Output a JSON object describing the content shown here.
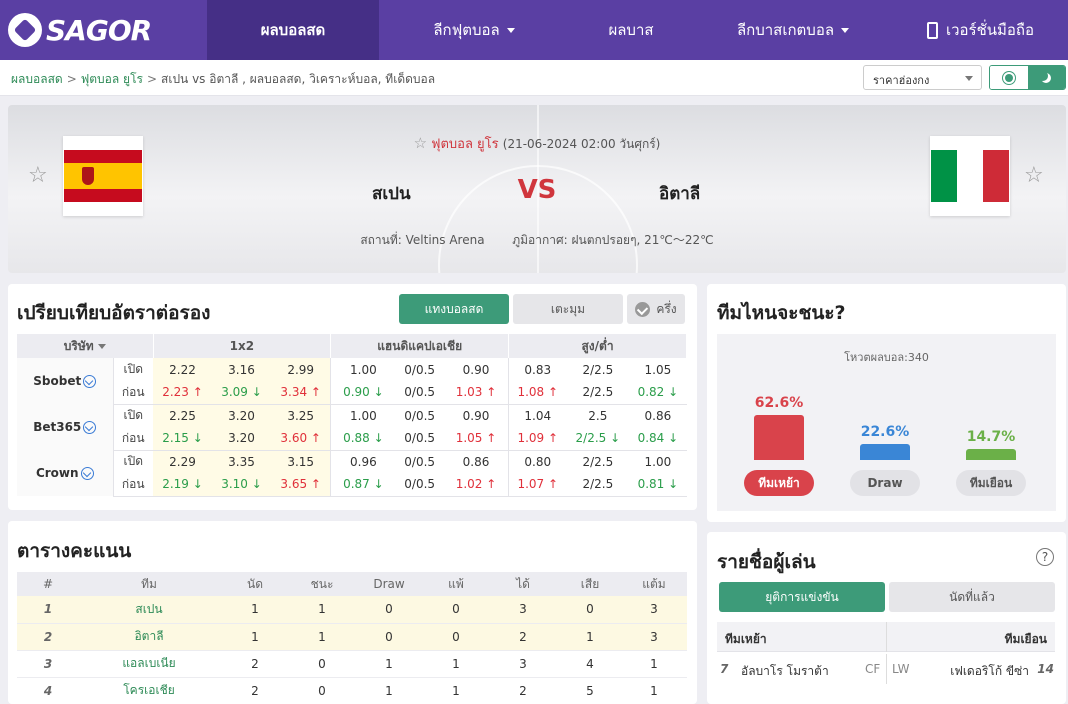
{
  "nav": {
    "logo": "SAGOR",
    "items": [
      {
        "label": "ผลบอลสด",
        "active": true,
        "caret": false
      },
      {
        "label": "ลีกฟุตบอล",
        "active": false,
        "caret": true
      },
      {
        "label": "ผลบาส",
        "active": false,
        "caret": false
      },
      {
        "label": "ลีกบาสเกตบอล",
        "active": false,
        "caret": true
      },
      {
        "label": "เวอร์ชั่นมือถือ",
        "active": false,
        "caret": false
      }
    ]
  },
  "breadcrumb": {
    "home": "ผลบอลสด",
    "league": "ฟุตบอล ยูโร",
    "current": "สเปน vs อิตาลี , ผลบอลสด, วิเคราะห์บอล, ทีเด็ดบอล"
  },
  "odds_select": {
    "value": "ราคาฮ่องกง"
  },
  "match": {
    "competition": "ฟุตบอล ยูโร",
    "datetime": "(21-06-2024 02:00 วันศุกร์)",
    "home": "สเปน",
    "away": "อิตาลี",
    "vs": "VS",
    "venue": "สถานที่: Veltins Arena",
    "weather": "ภูมิอากาศ: ฝนตกปรอยๆ, 21℃～22℃",
    "colors": {
      "spain_red": "#c60b1e",
      "spain_yellow": "#ffc400",
      "italy_green": "#009246",
      "italy_white": "#ffffff",
      "italy_red": "#ce2b37"
    }
  },
  "odds": {
    "title": "เปรียบเทียบอัตราต่อรอง",
    "btn_live": "แทงบอลสด",
    "btn_angle": "เตะมุม",
    "btn_half": "ครึ่ง",
    "headers": {
      "company": "บริษัท",
      "x12": "1x2",
      "handicap": "แฮนดิแคปเอเชีย",
      "ou": "สูง/ต่ำ"
    },
    "label_open": "เปิด",
    "label_before": "ก่อน",
    "rows": [
      {
        "book": "Sbobet",
        "open": [
          "2.22",
          "3.16",
          "2.99",
          "1.00",
          "0/0.5",
          "0.90",
          "0.83",
          "2/2.5",
          "1.05"
        ],
        "before": [
          "2.23",
          "3.09",
          "3.34",
          "0.90",
          "0/0.5",
          "1.03",
          "1.08",
          "2/2.5",
          "0.82"
        ],
        "dir": [
          "up",
          "dn",
          "up",
          "dn",
          "",
          "up",
          "up",
          "",
          "dn"
        ]
      },
      {
        "book": "Bet365",
        "open": [
          "2.25",
          "3.20",
          "3.25",
          "1.00",
          "0/0.5",
          "0.90",
          "1.04",
          "2.5",
          "0.86"
        ],
        "before": [
          "2.15",
          "3.20",
          "3.60",
          "0.88",
          "0/0.5",
          "1.05",
          "1.09",
          "2/2.5",
          "0.84"
        ],
        "dir": [
          "dn",
          "",
          "up",
          "dn",
          "",
          "up",
          "up",
          "dn",
          "dn"
        ]
      },
      {
        "book": "Crown",
        "open": [
          "2.29",
          "3.35",
          "3.15",
          "0.96",
          "0/0.5",
          "0.86",
          "0.80",
          "2/2.5",
          "1.00"
        ],
        "before": [
          "2.19",
          "3.10",
          "3.65",
          "0.87",
          "0/0.5",
          "1.02",
          "1.07",
          "2/2.5",
          "0.81"
        ],
        "dir": [
          "dn",
          "dn",
          "up",
          "dn",
          "",
          "up",
          "up",
          "",
          "dn"
        ]
      }
    ]
  },
  "standings": {
    "title": "ตารางคะแนน",
    "headers": [
      "#",
      "ทีม",
      "นัด",
      "ชนะ",
      "Draw",
      "แพ้",
      "ได้",
      "เสีย",
      "แต้ม"
    ],
    "rows": [
      [
        "1",
        "สเปน",
        "1",
        "1",
        "0",
        "0",
        "3",
        "0",
        "3"
      ],
      [
        "2",
        "อิตาลี",
        "1",
        "1",
        "0",
        "0",
        "2",
        "1",
        "3"
      ],
      [
        "3",
        "แอลเบเนีย",
        "2",
        "0",
        "1",
        "1",
        "3",
        "4",
        "1"
      ],
      [
        "4",
        "โครเอเชีย",
        "2",
        "0",
        "1",
        "1",
        "2",
        "5",
        "1"
      ]
    ]
  },
  "prediction": {
    "title": "ทีมไหนจะชนะ?",
    "votes": "โหวตผลบอล:340",
    "options": [
      {
        "pct": "62.6%",
        "value": 62.6,
        "label": "ทีมเหย้า",
        "color": "#d9434b"
      },
      {
        "pct": "22.6%",
        "value": 22.6,
        "label": "Draw",
        "color": "#3a86d6"
      },
      {
        "pct": "14.7%",
        "value": 14.7,
        "label": "ทีมเยือน",
        "color": "#6bb048"
      }
    ]
  },
  "players": {
    "title": "รายชื่อผู้เล่น",
    "help": "?",
    "tab_active": "ยุติการแข่งขัน",
    "tab_other": "นัดที่แล้ว",
    "home_header": "ทีมเหย้า",
    "away_header": "ทีมเยือน",
    "row": {
      "home_no": "7",
      "home_name": "อัลบาโร โมราต้า",
      "home_pos": "CF",
      "away_pos": "LW",
      "away_name": "เฟเดอริโก้ ขีซ่า",
      "away_no": "14"
    }
  }
}
